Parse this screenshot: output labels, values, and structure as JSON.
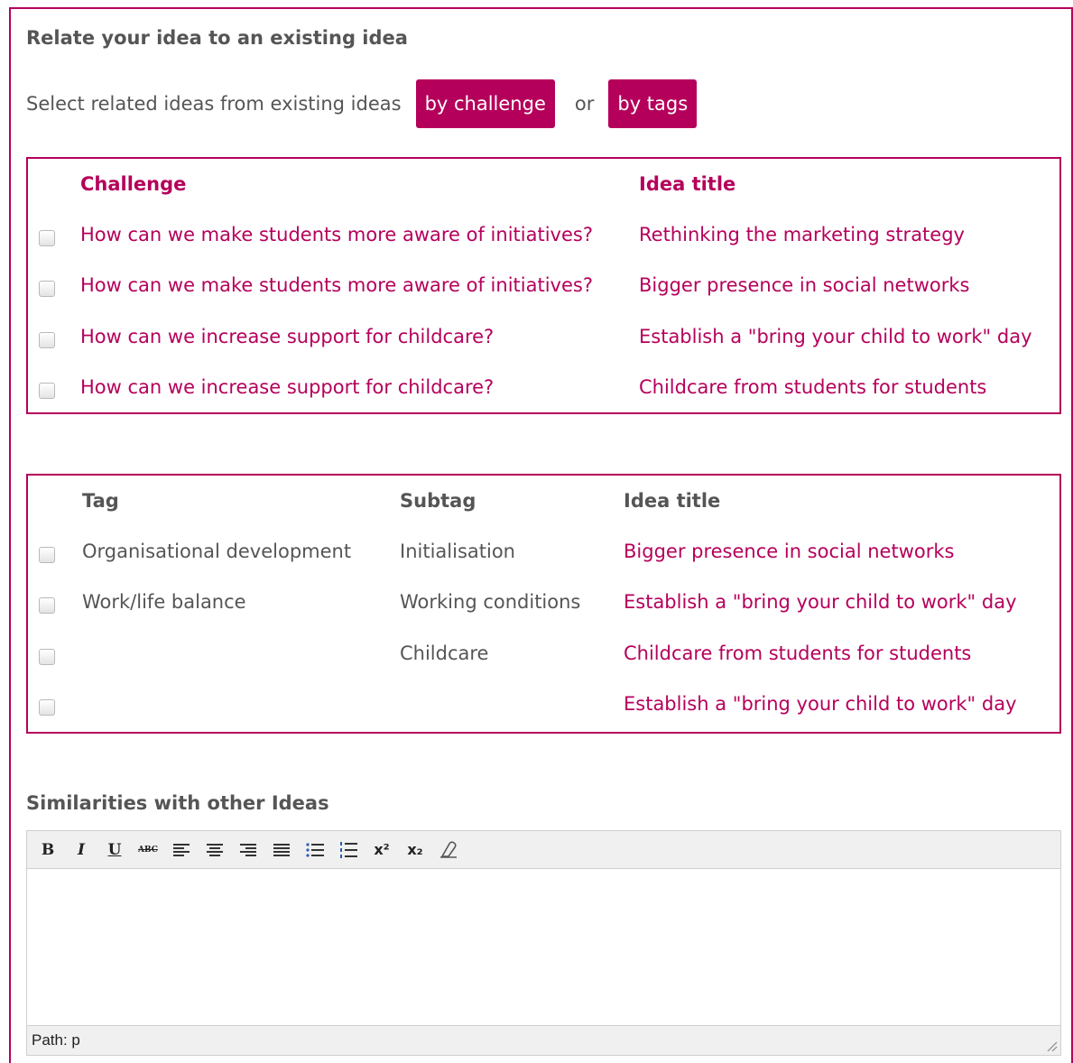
{
  "section": {
    "title": "Relate your idea to an existing idea",
    "select_text": "Select related ideas from existing ideas",
    "by_challenge_label": "by challenge",
    "or_text": "or",
    "by_tags_label": "by tags"
  },
  "challenge_table": {
    "headers": {
      "challenge": "Challenge",
      "idea_title": "Idea title"
    },
    "rows": [
      {
        "challenge": "How can we make students more aware of initiatives?",
        "idea_title": "Rethinking the marketing strategy"
      },
      {
        "challenge": "How can we make students more aware of initiatives?",
        "idea_title": "Bigger presence in social networks"
      },
      {
        "challenge": "How can we increase support for childcare?",
        "idea_title": "Establish a \"bring your child to work\" day"
      },
      {
        "challenge": "How can we increase support for childcare?",
        "idea_title": "Childcare from students for students"
      }
    ]
  },
  "tags_table": {
    "headers": {
      "tag": "Tag",
      "subtag": "Subtag",
      "idea_title": "Idea title"
    },
    "rows": [
      {
        "tag": "Organisational development",
        "subtag": "Initialisation",
        "idea_title": "Bigger presence in social networks"
      },
      {
        "tag": "Work/life balance",
        "subtag": "Working conditions",
        "idea_title": "Establish a \"bring your child to work\" day"
      },
      {
        "tag": "",
        "subtag": "Childcare",
        "idea_title": "Childcare from students for students"
      },
      {
        "tag": "",
        "subtag": "",
        "idea_title": "Establish a \"bring your child to work\" day"
      }
    ]
  },
  "similarities": {
    "title": "Similarities with other Ideas",
    "toolbar": {
      "bold": "B",
      "italic": "I",
      "underline": "U",
      "strikethrough": "ABC",
      "superscript": "x²",
      "subscript": "x₂"
    },
    "status_path": "Path: p"
  },
  "colors": {
    "accent": "#b5005b",
    "text": "#555555"
  }
}
